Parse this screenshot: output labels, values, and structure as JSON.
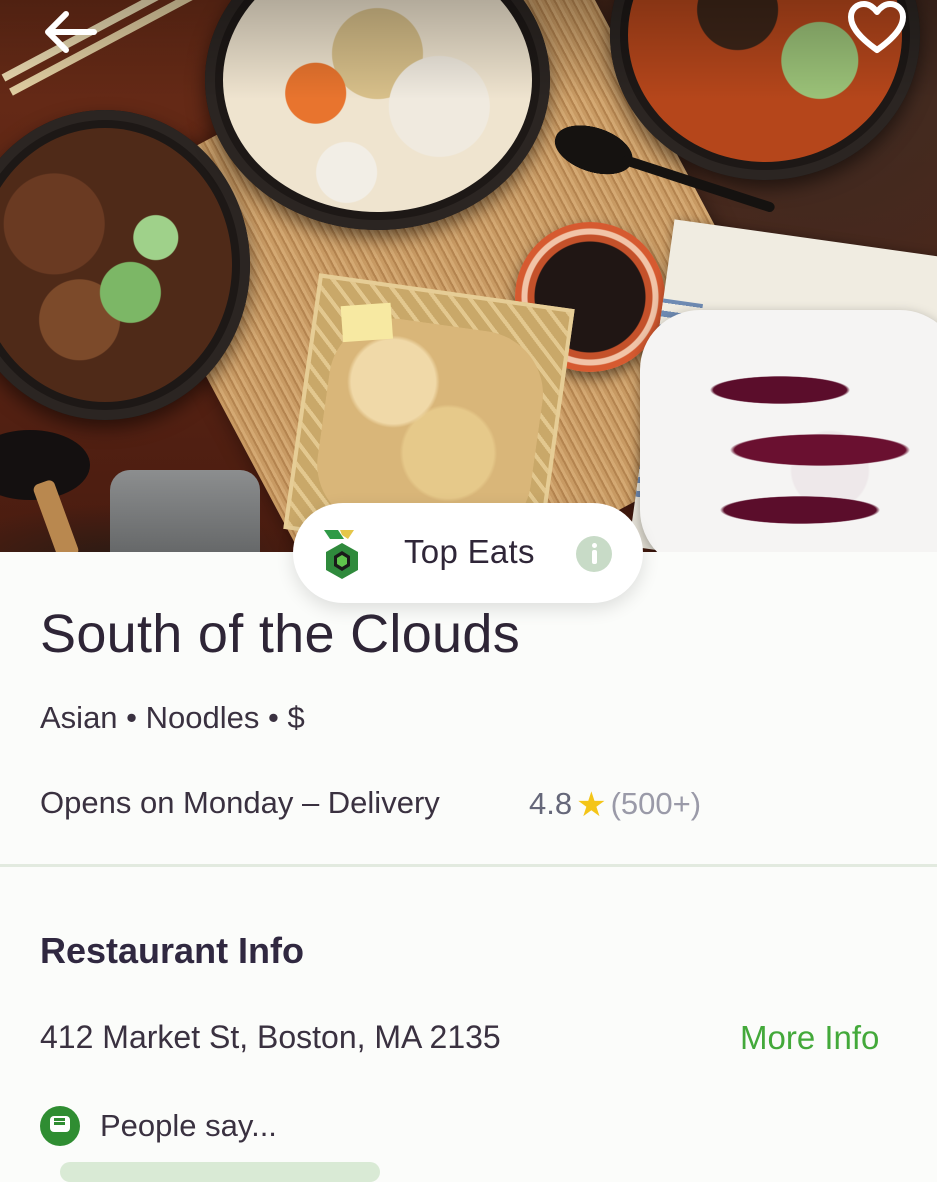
{
  "header": {
    "back_icon": "arrow-left-icon",
    "favorite_icon": "heart-outline-icon"
  },
  "badge": {
    "label": "Top Eats",
    "logo_icon": "top-eats-hexagon-icon",
    "info_icon": "info-icon"
  },
  "restaurant": {
    "name": "South of the Clouds",
    "tags": "Asian • Noodles • $",
    "status": "Opens on Monday – Delivery",
    "rating": "4.8",
    "rating_icon": "star-icon",
    "reviews": "(500+)"
  },
  "info_section": {
    "title": "Restaurant Info",
    "address": "412 Market St, Boston, MA 2135",
    "more_info_label": "More Info",
    "people_say_icon": "speech-bubble-icon",
    "people_say": "People say..."
  },
  "colors": {
    "accent_green": "#43a93a",
    "star_yellow": "#f4c518",
    "text_dark": "#2e2536"
  }
}
